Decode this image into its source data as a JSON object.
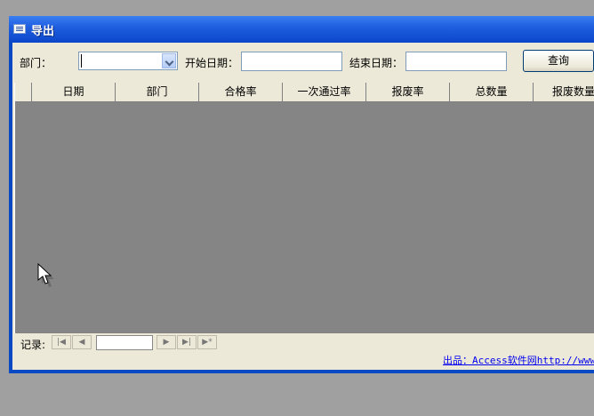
{
  "window": {
    "title": "导出"
  },
  "filters": {
    "department_label": "部门：",
    "department_value": "",
    "start_date_label": "开始日期：",
    "start_date_value": "",
    "end_date_label": "结束日期：",
    "end_date_value": "",
    "query_button": "查询"
  },
  "grid": {
    "columns": [
      "日期",
      "部门",
      "合格率",
      "一次通过率",
      "报废率",
      "总数量",
      "报废数量"
    ],
    "rows": []
  },
  "navigation": {
    "record_label": "记录:",
    "record_value": "",
    "first_icon": "first-record-icon",
    "prev_icon": "previous-record-icon",
    "next_icon": "next-record-icon",
    "last_icon": "last-record-icon",
    "new_icon": "new-record-icon"
  },
  "footer": {
    "link_text": "出品：Access软件网http://www.a"
  },
  "colors": {
    "titlebar": "#0b46c9",
    "client_bg": "#ece9d8",
    "grid_bg": "#858585",
    "link": "#0000ee"
  }
}
